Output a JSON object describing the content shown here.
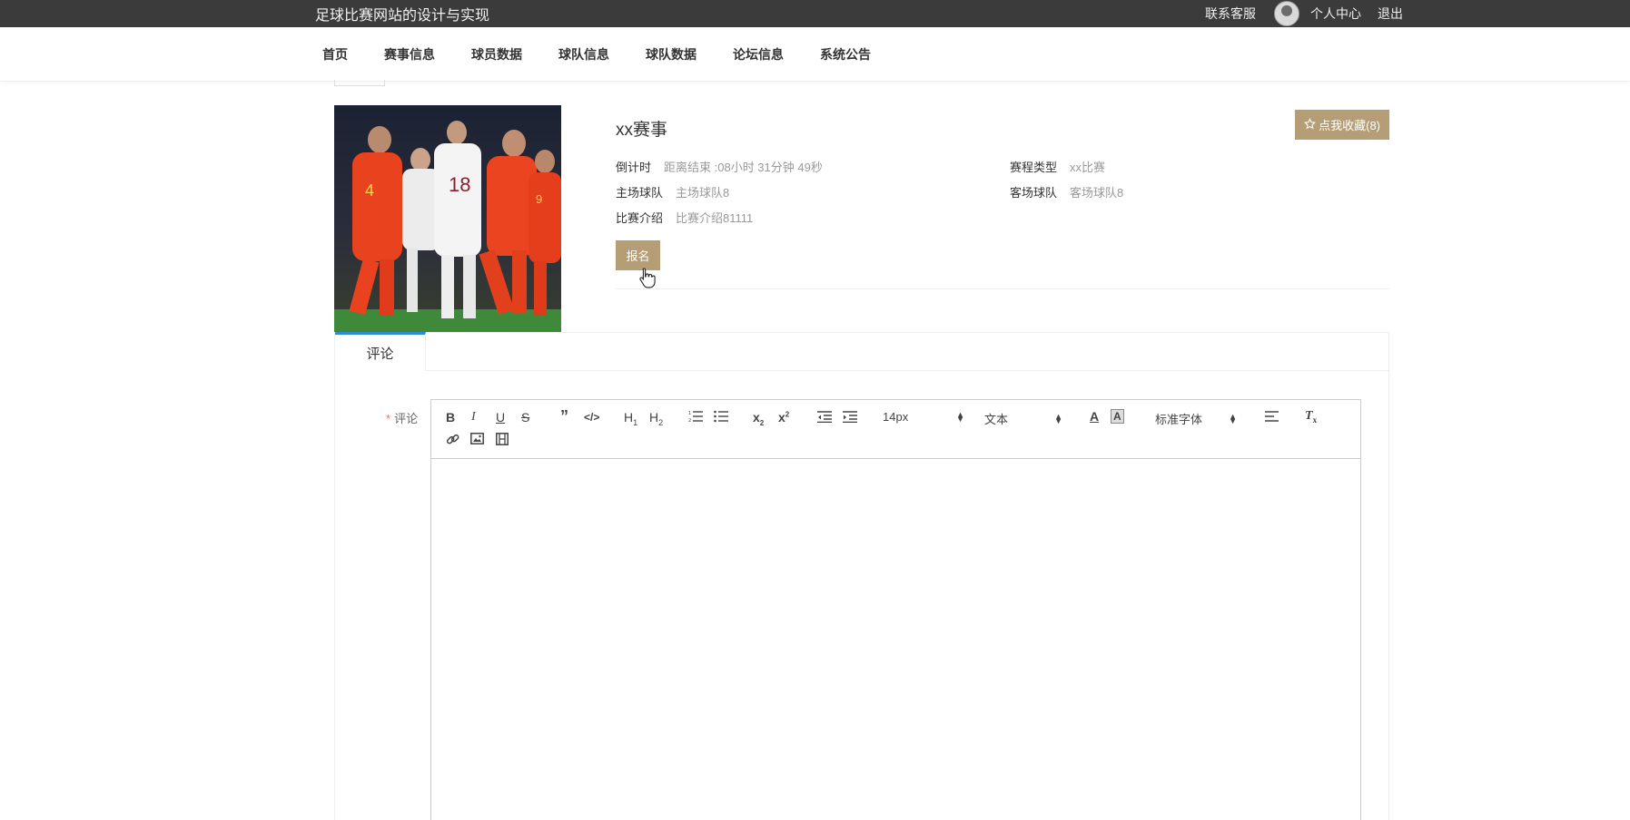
{
  "site": {
    "title": "足球比赛网站的设计与实现"
  },
  "topbar": {
    "contact": "联系客服",
    "personal_center": "个人中心",
    "logout": "退出"
  },
  "nav": {
    "items": [
      "首页",
      "赛事信息",
      "球员数据",
      "球队信息",
      "球队数据",
      "论坛信息",
      "系统公告"
    ]
  },
  "event": {
    "title": "xx赛事",
    "favorite_label": "点我收藏(8)",
    "countdown_label": "倒计时",
    "countdown_value": "距离结束 :08小时 31分钟 49秒",
    "schedule_type_label": "赛程类型",
    "schedule_type_value": "xx比赛",
    "home_team_label": "主场球队",
    "home_team_value": "主场球队8",
    "away_team_label": "客场球队",
    "away_team_value": "客场球队8",
    "intro_label": "比赛介绍",
    "intro_value": "比赛介绍81111",
    "signup_label": "报名"
  },
  "comments": {
    "tab_label": "评论",
    "field_label": "评论",
    "required_mark": "*",
    "toolbar": {
      "size_value": "14px",
      "header_value": "文本",
      "font_value": "标准字体",
      "sub_label": "x",
      "sup_label": "x",
      "h1_label": "H",
      "h2_label": "H"
    }
  },
  "colors": {
    "accent": "#b59e76",
    "topbar_bg": "#3b3b3b",
    "tab_active": "#2e8bd6",
    "required": "#f56c6c"
  }
}
